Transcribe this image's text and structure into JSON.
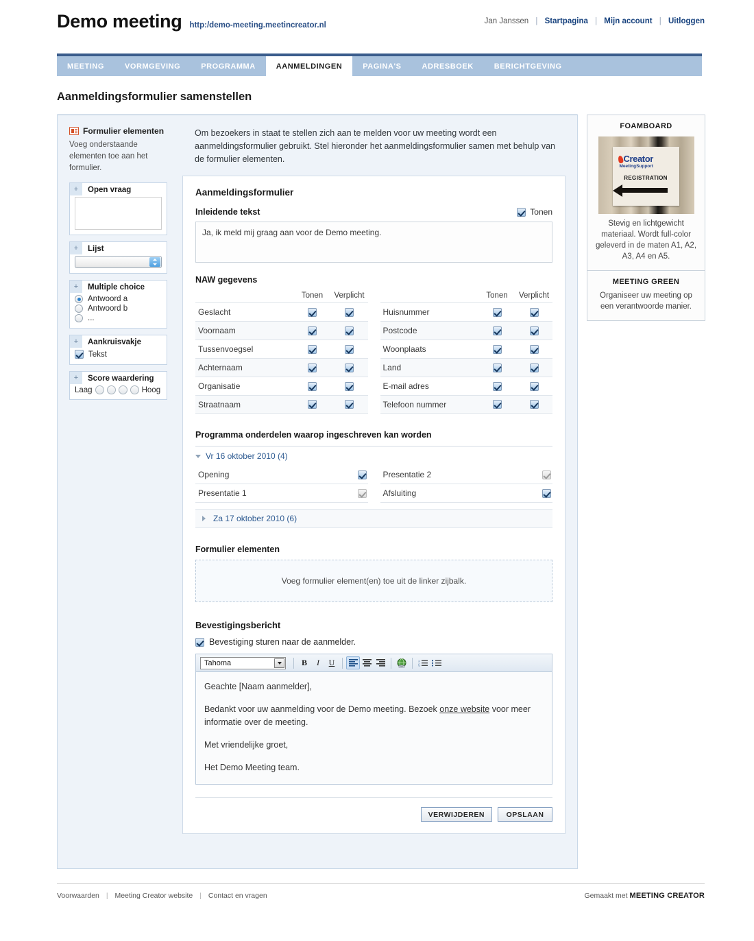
{
  "header": {
    "title": "Demo meeting",
    "url": "http:/demo-meeting.meetincreator.nl",
    "user": "Jan Janssen",
    "links": [
      "Startpagina",
      "Mijn account",
      "Uitloggen"
    ]
  },
  "tabs": [
    {
      "label": "MEETING",
      "active": false
    },
    {
      "label": "VORMGEVING",
      "active": false
    },
    {
      "label": "PROGRAMMA",
      "active": false
    },
    {
      "label": "AANMELDINGEN",
      "active": true
    },
    {
      "label": "PAGINA'S",
      "active": false
    },
    {
      "label": "ADRESBOEK",
      "active": false
    },
    {
      "label": "BERICHTGEVING",
      "active": false
    }
  ],
  "page_title": "Aanmeldingsformulier samenstellen",
  "sidebar": {
    "heading": "Formulier elementen",
    "description": "Voeg onderstaande elementen toe aan het formulier.",
    "widgets": {
      "open_vraag": {
        "title": "Open vraag",
        "plus": "+"
      },
      "lijst": {
        "title": "Lijst",
        "plus": "+"
      },
      "multiple_choice": {
        "title": "Multiple choice",
        "plus": "+",
        "options": [
          "Antwoord a",
          "Antwoord b",
          "..."
        ]
      },
      "aankruisvakje": {
        "title": "Aankruisvakje",
        "plus": "+",
        "option": "Tekst"
      },
      "score": {
        "title": "Score waardering",
        "plus": "+",
        "low": "Laag",
        "high": "Hoog",
        "dots": 4
      }
    }
  },
  "main": {
    "intro": "Om bezoekers in staat te stellen zich aan te melden voor uw meeting wordt een aanmeldingsformulier gebruikt. Stel hieronder het aanmeldingsformulier samen met behulp van de formulier elementen.",
    "form_title": "Aanmeldingsformulier",
    "inleidende_tekst": {
      "label": "Inleidende tekst",
      "tonen_label": "Tonen",
      "tonen_checked": true,
      "value": "Ja, ik meld mij graag aan voor de Demo meeting."
    },
    "naw": {
      "title": "NAW gegevens",
      "col_tonen": "Tonen",
      "col_verplicht": "Verplicht",
      "left": [
        {
          "label": "Geslacht",
          "tonen": true,
          "verplicht": true
        },
        {
          "label": "Voornaam",
          "tonen": true,
          "verplicht": true
        },
        {
          "label": "Tussenvoegsel",
          "tonen": true,
          "verplicht": true
        },
        {
          "label": "Achternaam",
          "tonen": true,
          "verplicht": true
        },
        {
          "label": "Organisatie",
          "tonen": true,
          "verplicht": true
        },
        {
          "label": "Straatnaam",
          "tonen": true,
          "verplicht": true
        }
      ],
      "right": [
        {
          "label": "Huisnummer",
          "tonen": true,
          "verplicht": true
        },
        {
          "label": "Postcode",
          "tonen": true,
          "verplicht": true
        },
        {
          "label": "Woonplaats",
          "tonen": true,
          "verplicht": true
        },
        {
          "label": "Land",
          "tonen": true,
          "verplicht": true
        },
        {
          "label": "E-mail adres",
          "tonen": true,
          "verplicht": true
        },
        {
          "label": "Telefoon nummer",
          "tonen": true,
          "verplicht": true
        }
      ]
    },
    "programma": {
      "title": "Programma onderdelen waarop ingeschreven kan worden",
      "day1": {
        "label": "Vr 16 oktober 2010 (4)",
        "expanded": true
      },
      "day2": {
        "label": "Za 17 oktober 2010 (6)",
        "expanded": false
      },
      "items_left": [
        {
          "label": "Opening",
          "checked": true,
          "enabled": true
        },
        {
          "label": "Presentatie 1",
          "checked": true,
          "enabled": false
        }
      ],
      "items_right": [
        {
          "label": "Presentatie 2",
          "checked": true,
          "enabled": false
        },
        {
          "label": "Afsluiting",
          "checked": true,
          "enabled": true
        }
      ]
    },
    "form_elements": {
      "label": "Formulier elementen",
      "dropzone_text": "Voeg formulier element(en) toe uit de linker zijbalk."
    },
    "bevestiging": {
      "title": "Bevestigingsbericht",
      "checkbox_label": "Bevestiging sturen naar de aanmelder.",
      "checked": true,
      "toolbar": {
        "font": "Tahoma",
        "bold": "B",
        "italic": "I",
        "underline": "U"
      },
      "body": {
        "p1": "Geachte [Naam aanmelder],",
        "p2a": "Bedankt voor uw aanmelding voor de Demo meeting. Bezoek ",
        "p2_link": "onze website",
        "p2b": " voor meer informatie over de meeting.",
        "p3": "Met vriendelijke groet,",
        "p4": "Het Demo Meeting team."
      }
    },
    "buttons": {
      "delete": "VERWIJDEREN",
      "save": "OPSLAAN"
    }
  },
  "right_sidebar": {
    "boxes": [
      {
        "title": "FOAMBOARD",
        "text": "Stevig en lichtgewicht materiaal. Wordt full-color geleverd in de maten A1, A2, A3, A4 en A5.",
        "image": {
          "logo": "Creator",
          "logo_sub_a": "Meeting",
          "logo_sub_b": "Support",
          "caption": "REGISTRATION"
        }
      },
      {
        "title": "MEETING GREEN",
        "text": "Organiseer uw meeting op een verantwoorde manier."
      }
    ]
  },
  "footer": {
    "links": [
      "Voorwaarden",
      "Meeting Creator website",
      "Contact en vragen"
    ],
    "made_prefix": "Gemaakt met",
    "made_brand": "MEETING CREATOR"
  }
}
